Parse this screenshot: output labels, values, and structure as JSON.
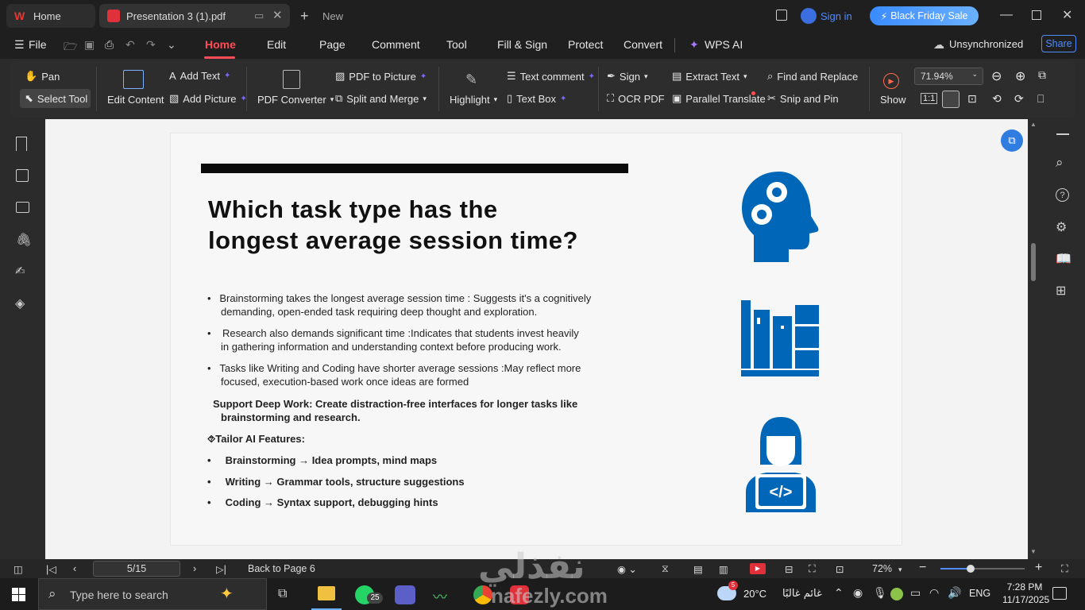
{
  "tabs": {
    "home": "Home",
    "document": "Presentation 3 (1).pdf",
    "new": "New"
  },
  "account": {
    "sign_in": "Sign in",
    "promo": "Black Friday Sale",
    "sync": "Unsynchronized",
    "share": "Share"
  },
  "menu": {
    "file": "File",
    "items": [
      "Home",
      "Edit",
      "Page",
      "Comment",
      "Tool",
      "Fill & Sign",
      "Protect",
      "Convert"
    ],
    "ai": "WPS AI"
  },
  "ribbon": {
    "pan": "Pan",
    "select_tool": "Select Tool",
    "edit_content": "Edit Content",
    "add_text": "Add Text",
    "add_picture": "Add Picture",
    "pdf_converter": "PDF Converter",
    "pdf_to_picture": "PDF to Picture",
    "split_merge": "Split and Merge",
    "highlight": "Highlight",
    "text_comment": "Text comment",
    "text_box": "Text Box",
    "sign": "Sign",
    "ocr": "OCR PDF",
    "extract_text": "Extract Text",
    "parallel_translate": "Parallel Translate",
    "find_replace": "Find and Replace",
    "snip_pin": "Snip and Pin",
    "show": "Show",
    "zoom": "71.94%",
    "one_to_one": "1:1"
  },
  "slide": {
    "title_line1": "Which task type has the",
    "title_line2": "longest average session time?",
    "bullet1_a": "Brainstorming takes the longest average session time : Suggests it's a cognitively",
    "bullet1_b": "demanding, open-ended task requiring deep thought and exploration.",
    "bullet2_a": "Research also demands significant time :Indicates that students invest heavily",
    "bullet2_b": "in gathering information and understanding context before producing work.",
    "bullet3_a": "Tasks like Writing and Coding have shorter average sessions :May reflect more",
    "bullet3_b": "focused, execution-based work once ideas are formed",
    "support_a": "Support Deep Work: Create distraction-free interfaces for longer tasks like",
    "support_b": "brainstorming and research.",
    "tailor": "⯑Tailor AI Features:",
    "feature1": "Brainstorming → Idea prompts, mind maps",
    "feature2": "Writing → Grammar tools, structure suggestions",
    "feature3": "Coding → Syntax support, debugging hints",
    "icon_color": "#0067b8"
  },
  "status": {
    "page": "5/15",
    "back": "Back to Page 6",
    "zoom": "72%"
  },
  "taskbar": {
    "search_placeholder": "Type here to search",
    "badge": "25",
    "weather_badge": "5",
    "temperature": "20°C",
    "weather_text": "غائم غالبًا",
    "lang": "ENG",
    "time": "7:28 PM",
    "date": "11/17/2025",
    "watermark": "nafezly.com",
    "watermark_ar": "نفذلي"
  }
}
